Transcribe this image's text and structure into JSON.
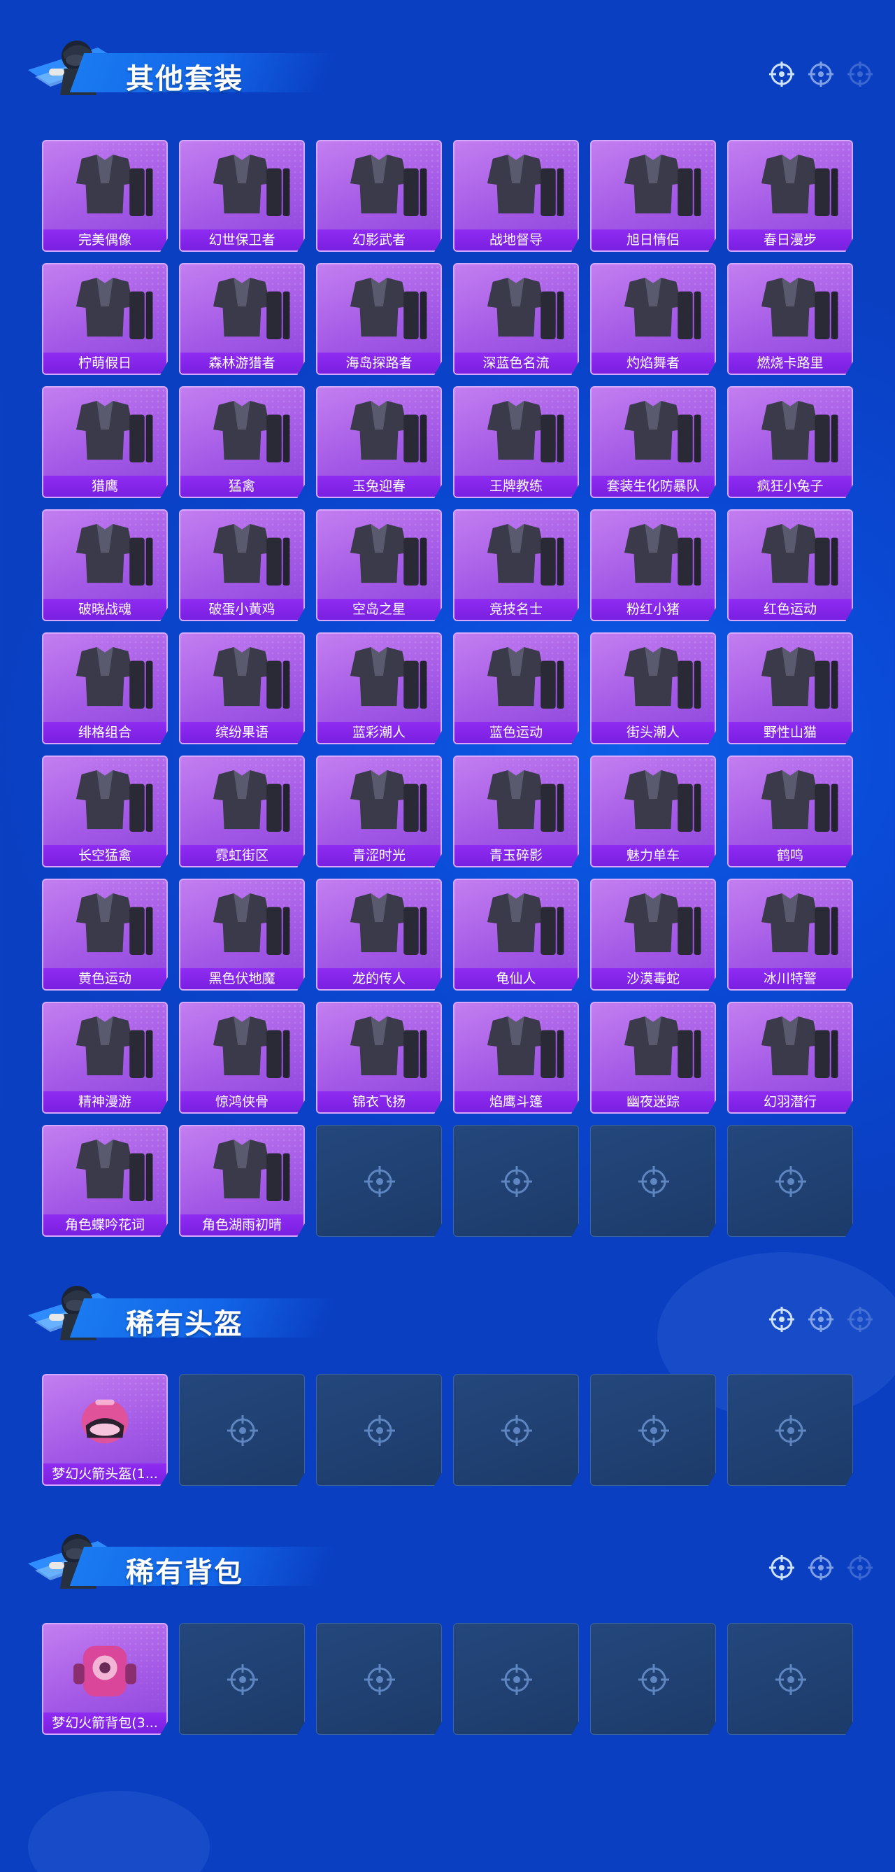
{
  "colors": {
    "background": "#0a4ad6",
    "card_purple": "#a45ae6",
    "label_purple": "#8f2cf2",
    "empty_slot": "#1c3b6a"
  },
  "sections": {
    "outfits": {
      "title": "其他套装",
      "items": [
        "完美偶像",
        "幻世保卫者",
        "幻影武者",
        "战地督导",
        "旭日情侣",
        "春日漫步",
        "柠萌假日",
        "森林游猎者",
        "海岛探路者",
        "深蓝色名流",
        "灼焰舞者",
        "燃烧卡路里",
        "猎鹰",
        "猛禽",
        "玉兔迎春",
        "王牌教练",
        "套装生化防暴队",
        "疯狂小兔子",
        "破晓战魂",
        "破蛋小黄鸡",
        "空岛之星",
        "竞技名士",
        "粉红小猪",
        "红色运动",
        "绯格组合",
        "缤纷果语",
        "蓝彩潮人",
        "蓝色运动",
        "街头潮人",
        "野性山猫",
        "长空猛禽",
        "霓虹街区",
        "青涩时光",
        "青玉碎影",
        "魅力单车",
        "鹤鸣",
        "黄色运动",
        "黑色伏地魔",
        "龙的传人",
        "龟仙人",
        "沙漠毒蛇",
        "冰川特警",
        "精神漫游",
        "惊鸿侠骨",
        "锦衣飞扬",
        "焰鹰斗篷",
        "幽夜迷踪",
        "幻羽潜行",
        "角色蝶吟花词",
        "角色湖雨初晴"
      ]
    },
    "helmets": {
      "title": "稀有头盔",
      "items": [
        "梦幻火箭头盔(1..."
      ]
    },
    "backpacks": {
      "title": "稀有背包",
      "items": [
        "梦幻火箭背包(3..."
      ]
    }
  },
  "icons": {
    "header_mascot": "mascot-soldier-icon",
    "header_reticle": "crosshair-icon",
    "empty_slot": "crosshair-icon"
  }
}
